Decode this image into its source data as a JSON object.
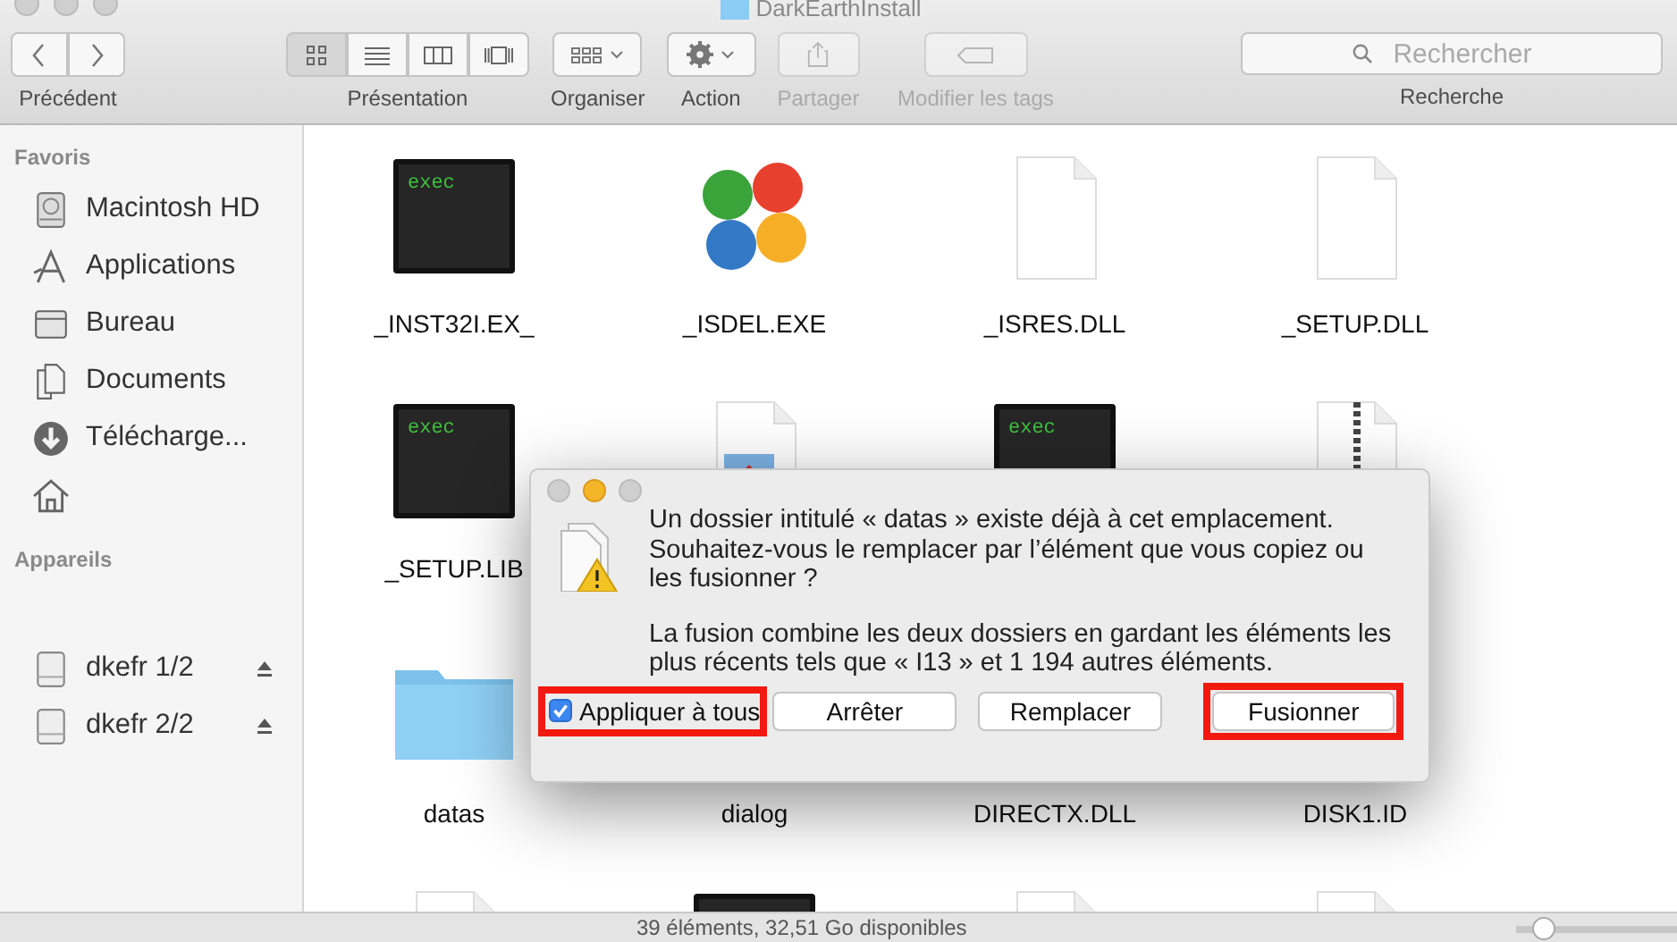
{
  "window": {
    "title": "DarkEarthInstall"
  },
  "toolbar": {
    "nav": {
      "label": "Précédent"
    },
    "view": {
      "label": "Présentation",
      "modes": [
        {
          "kind": "icons",
          "selected": true
        },
        {
          "kind": "list",
          "selected": false
        },
        {
          "kind": "columns",
          "selected": false
        },
        {
          "kind": "cover",
          "selected": false
        }
      ]
    },
    "organize": {
      "label": "Organiser"
    },
    "action": {
      "label": "Action"
    },
    "share": {
      "label": "Partager",
      "disabled": true
    },
    "tags": {
      "label": "Modifier les tags",
      "disabled": true
    },
    "search": {
      "placeholder": "Rechercher",
      "label": "Recherche"
    }
  },
  "sidebar": {
    "sections": [
      {
        "title": "Favoris",
        "items": [
          {
            "kind": "disk",
            "label": "Macintosh HD"
          },
          {
            "kind": "apps",
            "label": "Applications"
          },
          {
            "kind": "desktop",
            "label": "Bureau"
          },
          {
            "kind": "docs",
            "label": "Documents"
          },
          {
            "kind": "download",
            "label": "Télécharge..."
          },
          {
            "kind": "home"
          }
        ]
      },
      {
        "title": "Appareils",
        "items": [
          {
            "kind": "drive",
            "label": "dkefr 1/2",
            "eject": true
          },
          {
            "kind": "drive",
            "label": "dkefr 2/2",
            "eject": true
          }
        ]
      }
    ]
  },
  "files": [
    {
      "kind": "exec",
      "badge": "exec",
      "name": "_INST32I.EX_"
    },
    {
      "kind": "clover",
      "name": "_ISDEL.EXE"
    },
    {
      "kind": "doc",
      "name": "_ISRES.DLL"
    },
    {
      "kind": "doc",
      "name": "_SETUP.DLL"
    },
    {
      "kind": "exec",
      "badge": "exec",
      "name": "_SETUP.LIB"
    },
    {
      "kind": "image"
    },
    {
      "kind": "exec",
      "badge": "exec"
    },
    {
      "kind": "zip"
    },
    {
      "kind": "folder",
      "name": "datas"
    },
    {
      "kind": "doc",
      "name": "dialog"
    },
    {
      "kind": "doc",
      "name": "DIRECTX.DLL"
    },
    {
      "kind": "doc",
      "name": "DISK1.ID"
    },
    {
      "kind": "doc"
    },
    {
      "kind": "exec"
    },
    {
      "kind": "doc"
    },
    {
      "kind": "doc"
    }
  ],
  "dialog": {
    "message": "Un dossier intitulé « datas » existe déjà à cet emplacement. Souhaitez-vous le remplacer par l’élément que vous copiez ou les fusionner ?",
    "detail": "La fusion combine les deux dossiers en gardant les éléments les plus récents tels que « I13 » et 1 194 autres éléments.",
    "checkbox": {
      "label": "Appliquer à tous",
      "checked": true,
      "highlighted": true
    },
    "buttons": [
      {
        "label": "Arrêter",
        "highlighted": false
      },
      {
        "label": "Remplacer",
        "highlighted": false
      },
      {
        "label": "Fusionner",
        "highlighted": true
      }
    ]
  },
  "status_bar": {
    "text": "39 éléments, 32,51 Go disponibles",
    "zoom": {
      "level": 0.12
    }
  }
}
